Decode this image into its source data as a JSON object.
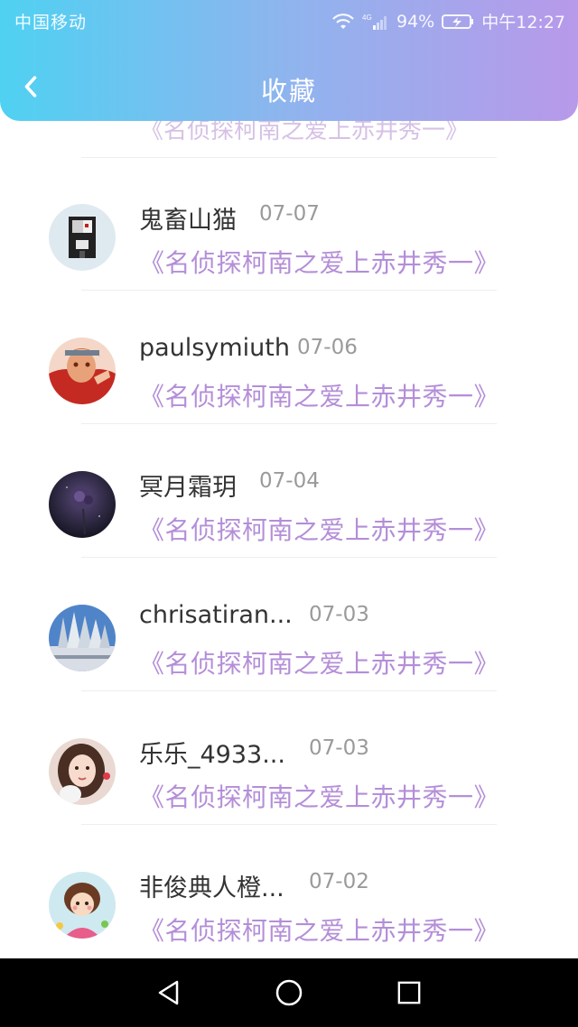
{
  "status_bar": {
    "carrier": "中国移动",
    "network": "4G",
    "battery": "94%",
    "time": "中午12:27"
  },
  "app_bar": {
    "title": "收藏"
  },
  "list": {
    "partial_title": "《名侦探柯南之爱上赤井秀一》",
    "items": [
      {
        "username": "鬼畜山猫",
        "date": "07-07",
        "title": "《名侦探柯南之爱上赤井秀一》"
      },
      {
        "username": "paulsymiuth",
        "date": "07-06",
        "title": "《名侦探柯南之爱上赤井秀一》"
      },
      {
        "username": "冥月霜玥",
        "date": "07-04",
        "title": "《名侦探柯南之爱上赤井秀一》"
      },
      {
        "username": "chrisatiran...",
        "date": "07-03",
        "title": "《名侦探柯南之爱上赤井秀一》"
      },
      {
        "username": "乐乐_4933...",
        "date": "07-03",
        "title": "《名侦探柯南之爱上赤井秀一》"
      },
      {
        "username": "非俊典人橙...",
        "date": "07-02",
        "title": "《名侦探柯南之爱上赤井秀一》"
      }
    ]
  },
  "icons": {
    "back": "chevron-left-icon",
    "wifi": "wifi-icon",
    "signal": "signal-icon",
    "battery": "battery-icon",
    "nav_back": "triangle-back-icon",
    "nav_home": "circle-home-icon",
    "nav_recent": "square-recent-icon"
  },
  "colors": {
    "accent_title": "#b48ed8",
    "header_start": "#4fd1f2",
    "header_end": "#b899ea"
  }
}
